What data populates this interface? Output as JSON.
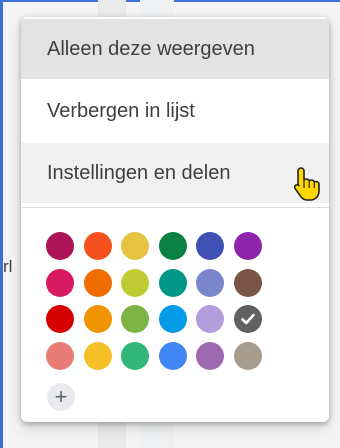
{
  "background": {
    "partial_text": "rl"
  },
  "menu": {
    "items": [
      {
        "label": "Alleen deze weergeven"
      },
      {
        "label": "Verbergen in lijst"
      },
      {
        "label": "Instellingen en delen"
      }
    ],
    "colors": [
      {
        "hex": "#ad1457",
        "selected": false
      },
      {
        "hex": "#f4511e",
        "selected": false
      },
      {
        "hex": "#e4c441",
        "selected": false
      },
      {
        "hex": "#0b8043",
        "selected": false
      },
      {
        "hex": "#3f51b5",
        "selected": false
      },
      {
        "hex": "#8e24aa",
        "selected": false
      },
      {
        "hex": "#d81b60",
        "selected": false
      },
      {
        "hex": "#ef6c00",
        "selected": false
      },
      {
        "hex": "#c0ca33",
        "selected": false
      },
      {
        "hex": "#009688",
        "selected": false
      },
      {
        "hex": "#7986cb",
        "selected": false
      },
      {
        "hex": "#795548",
        "selected": false
      },
      {
        "hex": "#d50000",
        "selected": false
      },
      {
        "hex": "#f09300",
        "selected": false
      },
      {
        "hex": "#7cb342",
        "selected": false
      },
      {
        "hex": "#039be5",
        "selected": false
      },
      {
        "hex": "#b39ddb",
        "selected": false
      },
      {
        "hex": "#616161",
        "selected": true
      },
      {
        "hex": "#e67c73",
        "selected": false
      },
      {
        "hex": "#f6bf26",
        "selected": false
      },
      {
        "hex": "#33b679",
        "selected": false
      },
      {
        "hex": "#4285f4",
        "selected": false
      },
      {
        "hex": "#9e69af",
        "selected": false
      },
      {
        "hex": "#a79b8e",
        "selected": false
      }
    ],
    "add_color": {
      "symbol": "+",
      "icon": "plus-icon"
    }
  },
  "cursor": {
    "icon": "hand-pointer-icon",
    "color": "#ffd700"
  }
}
